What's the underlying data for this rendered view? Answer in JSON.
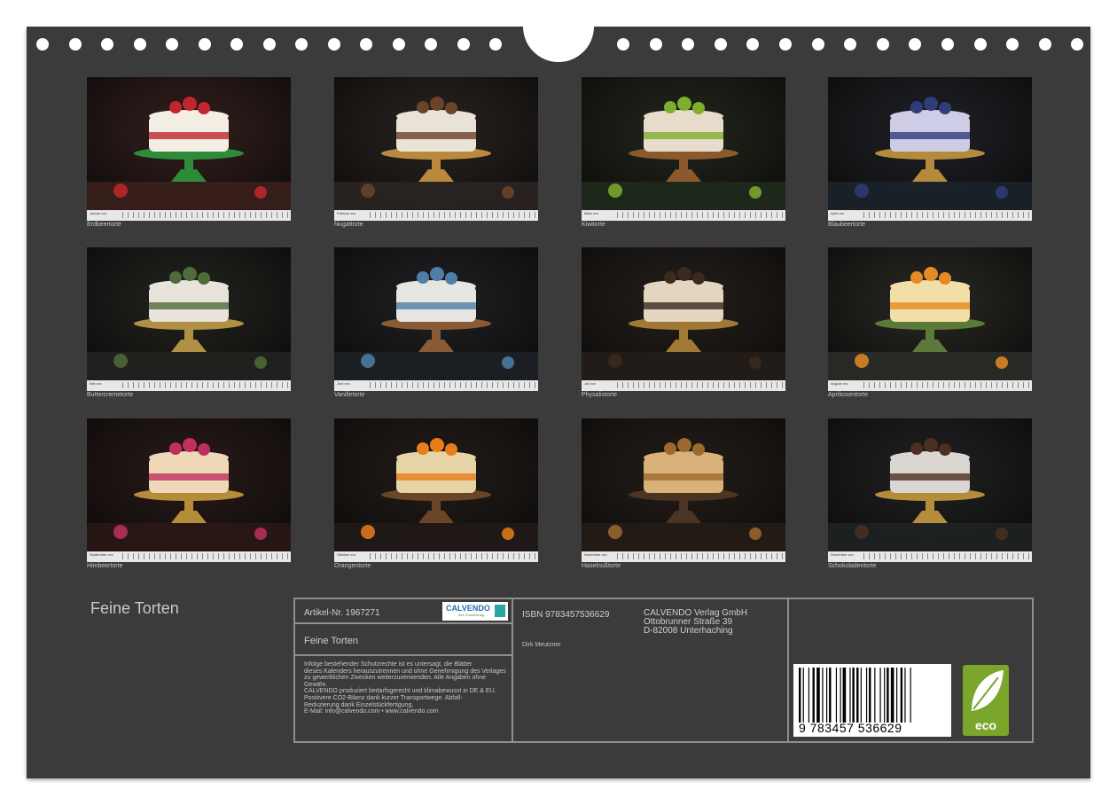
{
  "calendar": {
    "title": "Feine Torten"
  },
  "months": [
    {
      "tab": "Januar xxx",
      "caption": "Erdbeertorte",
      "palette": [
        "#3a1f1c",
        "#f3ede4",
        "#c0272d",
        "#2e8b3a"
      ]
    },
    {
      "tab": "Februar xxx",
      "caption": "Nugattorte",
      "palette": [
        "#2a2522",
        "#e9e2d6",
        "#6b4428",
        "#b98a3d"
      ]
    },
    {
      "tab": "März xxx",
      "caption": "Kiwitorte",
      "palette": [
        "#1f2a1c",
        "#e7dccb",
        "#7fae2e",
        "#8a5a2c"
      ]
    },
    {
      "tab": "April xxx",
      "caption": "Blaubeertorte",
      "palette": [
        "#1c222b",
        "#cfcde6",
        "#2f3d79",
        "#b48a3d"
      ]
    },
    {
      "tab": "Mai xxx",
      "caption": "Buttercremetorte",
      "palette": [
        "#222420",
        "#e8e4dc",
        "#4f6b3a",
        "#b09045"
      ]
    },
    {
      "tab": "Juni xxx",
      "caption": "Vanilletorte",
      "palette": [
        "#1d2126",
        "#e7e5e2",
        "#4f7fa6",
        "#8a5a34"
      ]
    },
    {
      "tab": "Juli xxx",
      "caption": "Physalistorte",
      "palette": [
        "#241e19",
        "#e3d6c0",
        "#3b2a1f",
        "#a17937"
      ]
    },
    {
      "tab": "August xxx",
      "caption": "Aprikosentorte",
      "palette": [
        "#2a2c27",
        "#f2dfa8",
        "#e58a24",
        "#5b7a3a"
      ]
    },
    {
      "tab": "September xxx",
      "caption": "Himbeertorte",
      "palette": [
        "#2a1815",
        "#efd8b7",
        "#c0305f",
        "#b58d3a"
      ]
    },
    {
      "tab": "Oktober xxx",
      "caption": "Orangentorte",
      "palette": [
        "#201a17",
        "#e6d3a6",
        "#e87d1b",
        "#6a4526"
      ]
    },
    {
      "tab": "November xxx",
      "caption": "Haselnußtorte",
      "palette": [
        "#241c16",
        "#d9b27a",
        "#9c6a2f",
        "#4b3421"
      ]
    },
    {
      "tab": "Dezember xxx",
      "caption": "Schokoladentorte",
      "palette": [
        "#1f2224",
        "#dcd6d2",
        "#4b2f22",
        "#b58d3a"
      ]
    }
  ],
  "info": {
    "article": "Artikel-Nr. 1967271",
    "brand": "CALVENDO",
    "brand_sub": "Ihre Kunstverlag",
    "title": "Feine Torten",
    "legal": [
      "Infolge bestehender Schutzrechte ist es untersagt, die Blätter",
      "dieses Kalenders herauszutrennen und ohne Genehmigung des Verlages",
      "zu gewerblichen Zwecken weiterzuverwenden. Alle Angaben ohne",
      "Gewähr.",
      "CALVENDO produziert bedarfsgerecht und klimabewusst in DE & EU.",
      "Positivere CO2-Bilanz dank kurzer Transportwege. Abfall-",
      "Reduzierung dank Einzelstückfertigung.",
      "E-Mail: info@calvendo.com • www.calvendo.com"
    ],
    "isbn": "ISBN 9783457536629",
    "author": "Dirk Meutzner",
    "publisher": [
      "CALVENDO Verlag GmbH",
      "Ottobrunner Straße 39",
      "D-82008 Unterhaching"
    ],
    "barcode_digits": "9 783457 536629",
    "eco_label": "eco"
  }
}
